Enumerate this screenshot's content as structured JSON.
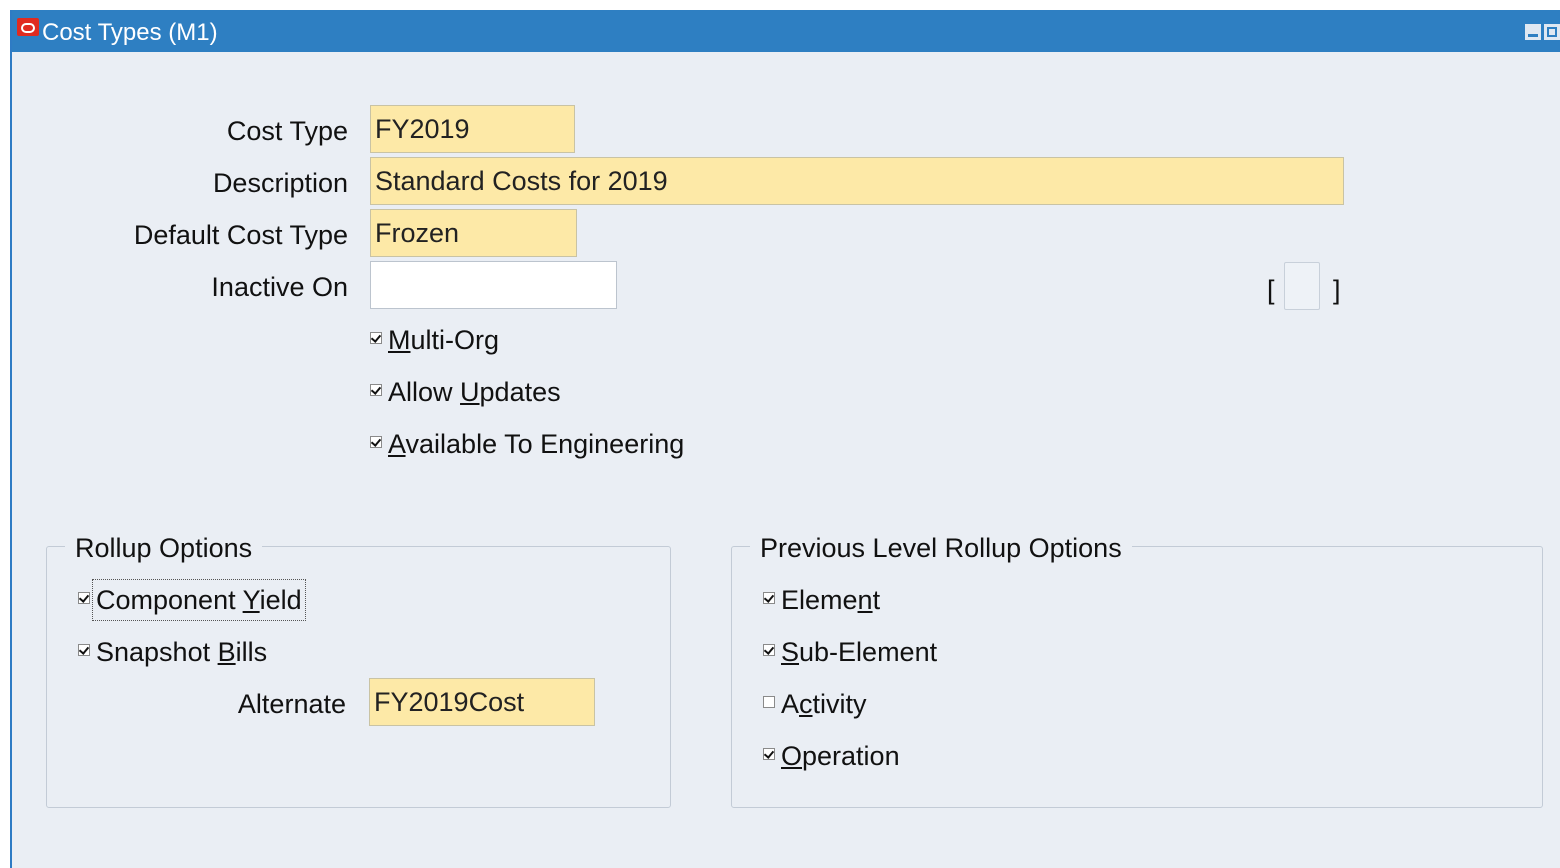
{
  "window": {
    "title": "Cost Types (M1)"
  },
  "form": {
    "cost_type": {
      "label": "Cost Type",
      "value": "FY2019"
    },
    "description": {
      "label": "Description",
      "value": "Standard Costs for 2019"
    },
    "default_cost_type": {
      "label": "Default Cost Type",
      "value": "Frozen"
    },
    "inactive_on": {
      "label": "Inactive On",
      "value": ""
    },
    "bracket_open": "[",
    "bracket_close": "]",
    "multi_org": {
      "label_pre": "",
      "label_acc": "M",
      "label_post": "ulti-Org",
      "checked": true
    },
    "allow_updates": {
      "label_pre": "Allow ",
      "label_acc": "U",
      "label_post": "pdates",
      "checked": true
    },
    "available_to_engineering": {
      "label_pre": "",
      "label_acc": "A",
      "label_post": "vailable To Engineering",
      "checked": true
    }
  },
  "rollup_options": {
    "title": "Rollup Options",
    "component_yield": {
      "label_pre": "Component ",
      "label_acc": "Y",
      "label_post": "ield",
      "checked": true
    },
    "snapshot_bills": {
      "label_pre": "Snapshot ",
      "label_acc": "B",
      "label_post": "ills",
      "checked": true
    },
    "alternate": {
      "label": "Alternate",
      "value": "FY2019Cost"
    }
  },
  "previous_level_rollup_options": {
    "title": "Previous Level Rollup Options",
    "element": {
      "label_pre": "Eleme",
      "label_acc": "n",
      "label_post": "t",
      "checked": true
    },
    "sub_element": {
      "label_pre": "",
      "label_acc": "S",
      "label_post": "ub-Element",
      "checked": true
    },
    "activity": {
      "label_pre": "A",
      "label_acc": "c",
      "label_post": "tivity",
      "checked": false
    },
    "operation": {
      "label_pre": "",
      "label_acc": "O",
      "label_post": "peration",
      "checked": true
    }
  },
  "colors": {
    "titlebar": "#2e7fc2",
    "required_field": "#fde9a7",
    "window_bg": "#eaeef4"
  }
}
